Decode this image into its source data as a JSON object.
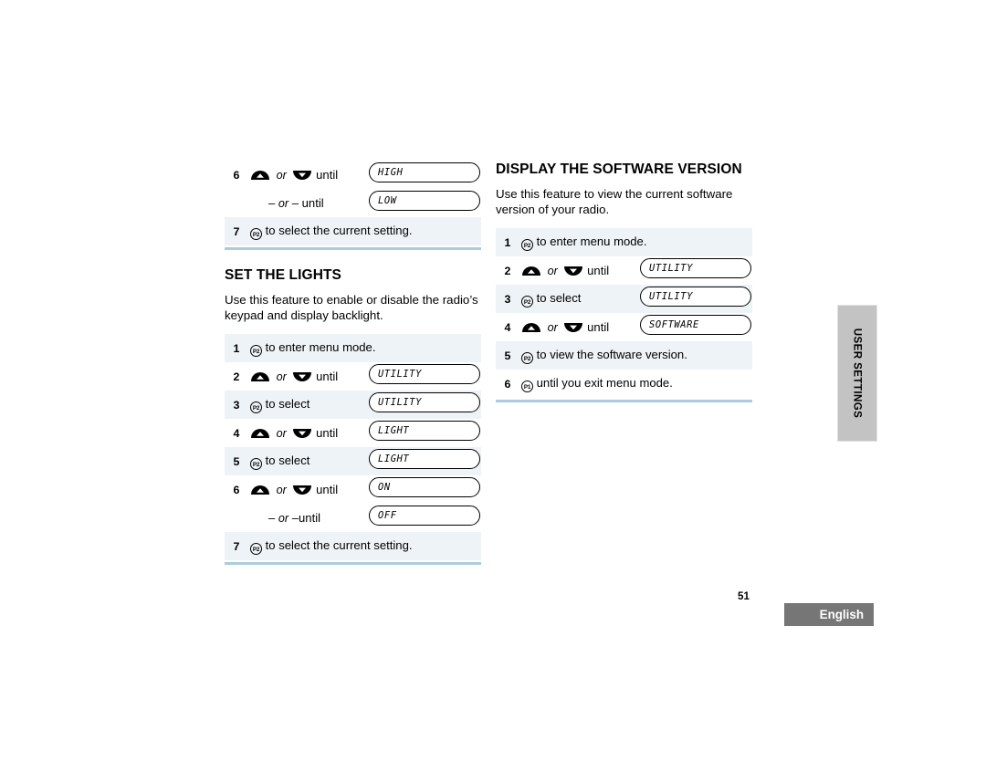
{
  "page": {
    "number": "51",
    "language_badge": "English",
    "side_tab": "USER SETTINGS"
  },
  "left_column": {
    "continued_table": {
      "rows": [
        {
          "num": "6",
          "action_prefix": "",
          "keys": "up-down",
          "or_label": "or",
          "action_suffix": "until",
          "lcd": "HIGH",
          "shaded": false
        },
        {
          "num": "",
          "action_prefix": "–",
          "or_label": "or",
          "action_suffix": "– until",
          "lcd": "LOW",
          "shaded": false
        },
        {
          "num": "7",
          "key": "P2",
          "action": "to select the current setting.",
          "lcd": "",
          "shaded": true
        }
      ]
    },
    "section": {
      "title": "SET THE LIGHTS",
      "intro": "Use this feature to enable or disable the radio’s keypad and display backlight.",
      "rows": [
        {
          "num": "1",
          "key": "P2",
          "action": "to enter menu mode.",
          "lcd": "",
          "shaded": true
        },
        {
          "num": "2",
          "keys": "up-down",
          "or_label": "or",
          "action_suffix": "until",
          "lcd": "UTILITY",
          "shaded": false
        },
        {
          "num": "3",
          "key": "P2",
          "action": "to select",
          "lcd": "UTILITY",
          "shaded": true
        },
        {
          "num": "4",
          "keys": "up-down",
          "or_label": "or",
          "action_suffix": "until",
          "lcd": "LIGHT",
          "shaded": false
        },
        {
          "num": "5",
          "key": "P2",
          "action": "to select",
          "lcd": "LIGHT",
          "shaded": true
        },
        {
          "num": "6",
          "keys": "up-down",
          "or_label": "or",
          "action_suffix": "until",
          "lcd": "ON",
          "shaded": false
        },
        {
          "num": "",
          "action_prefix": "–",
          "or_label": "or",
          "action_suffix": "–until",
          "lcd": "OFF",
          "shaded": false
        },
        {
          "num": "7",
          "key": "P2",
          "action": "to select the current setting.",
          "lcd": "",
          "shaded": true
        }
      ]
    }
  },
  "right_column": {
    "section": {
      "title": "DISPLAY THE SOFTWARE VERSION",
      "intro": "Use this feature to view the current software version of your radio.",
      "rows": [
        {
          "num": "1",
          "key": "P2",
          "action": "to enter menu mode.",
          "lcd": "",
          "shaded": true
        },
        {
          "num": "2",
          "keys": "up-down",
          "or_label": "or",
          "action_suffix": "until",
          "lcd": "UTILITY",
          "shaded": false
        },
        {
          "num": "3",
          "key": "P2",
          "action": "to select",
          "lcd": "UTILITY",
          "shaded": true
        },
        {
          "num": "4",
          "keys": "up-down",
          "or_label": "or",
          "action_suffix": "until",
          "lcd": "SOFTWARE",
          "shaded": false
        },
        {
          "num": "5",
          "key": "P2",
          "action": "to view the software version.",
          "lcd": "",
          "shaded": true
        },
        {
          "num": "6",
          "key": "P1",
          "action": "until you exit menu mode.",
          "lcd": "",
          "shaded": false
        }
      ]
    }
  },
  "colors": {
    "row_shade": "#eef3f7",
    "rule": "#a9cce2",
    "side_tab_bg": "#c3c3c3",
    "badge_bg": "#767676"
  }
}
